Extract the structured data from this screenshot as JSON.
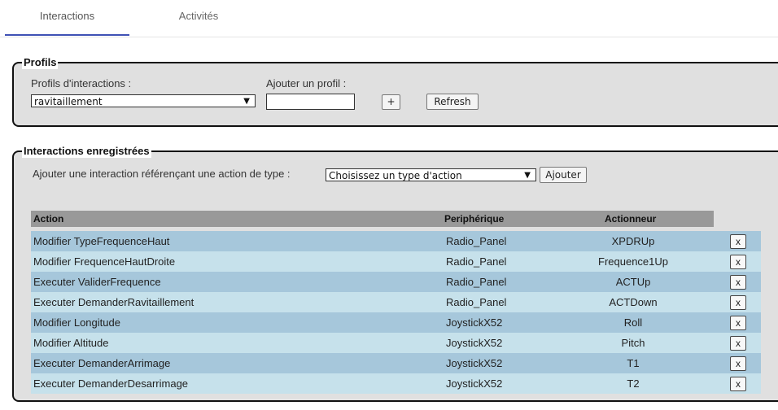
{
  "tabs": [
    {
      "label": "Interactions",
      "active": true
    },
    {
      "label": "Activités",
      "active": false
    }
  ],
  "profils": {
    "legend": "Profils",
    "select_label": "Profils d'interactions :",
    "selected_profile": "ravitaillement",
    "add_label": "Ajouter un profil :",
    "add_input_value": "",
    "plus_button": "+",
    "refresh_button": "Refresh"
  },
  "interactions": {
    "legend": "Interactions enregistrées",
    "add_prompt": "Ajouter une interaction référençant une action de type :",
    "action_type_selected": "Choisissez un type d'action",
    "add_button": "Ajouter",
    "columns": [
      "Action",
      "Periphérique",
      "Actionneur"
    ],
    "delete_label": "x",
    "rows": [
      {
        "action": "Modifier TypeFrequenceHaut",
        "peripherique": "Radio_Panel",
        "actionneur": "XPDRUp"
      },
      {
        "action": "Modifier FrequenceHautDroite",
        "peripherique": "Radio_Panel",
        "actionneur": "Frequence1Up"
      },
      {
        "action": "Executer ValiderFrequence",
        "peripherique": "Radio_Panel",
        "actionneur": "ACTUp"
      },
      {
        "action": "Executer DemanderRavitaillement",
        "peripherique": "Radio_Panel",
        "actionneur": "ACTDown"
      },
      {
        "action": "Modifier Longitude",
        "peripherique": "JoystickX52",
        "actionneur": "Roll"
      },
      {
        "action": "Modifier Altitude",
        "peripherique": "JoystickX52",
        "actionneur": "Pitch"
      },
      {
        "action": "Executer DemanderArrimage",
        "peripherique": "JoystickX52",
        "actionneur": "T1"
      },
      {
        "action": "Executer DemanderDesarrimage",
        "peripherique": "JoystickX52",
        "actionneur": "T2"
      }
    ]
  },
  "colors": {
    "tab_underline": "#3f51b5",
    "row_dark": "#a6c7db",
    "row_light": "#c6e1eb",
    "header_bg": "#999999",
    "fieldset_bg": "#e0e0e0"
  }
}
